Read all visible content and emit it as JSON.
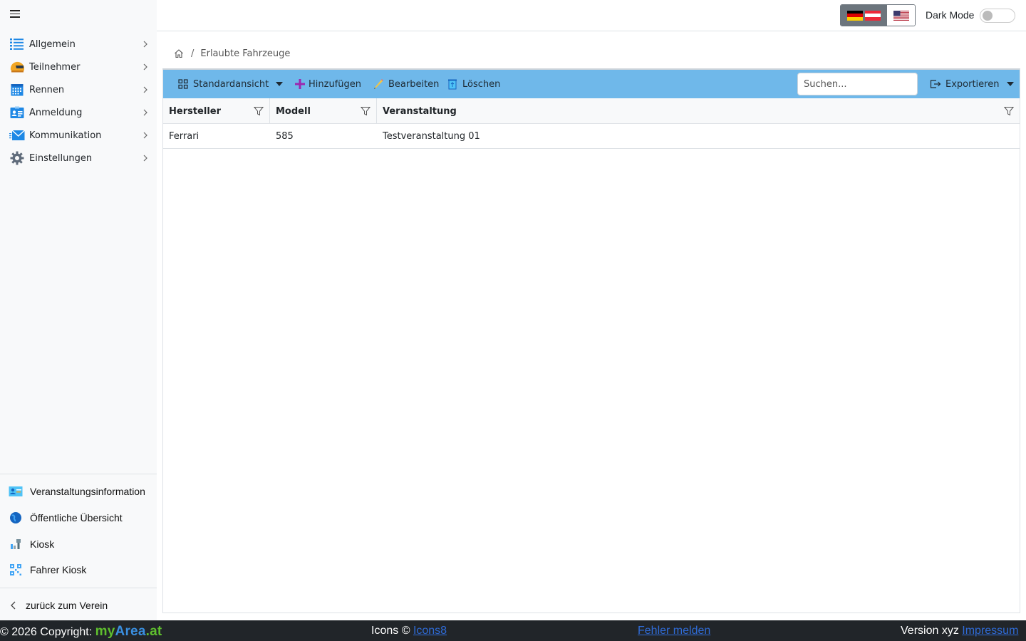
{
  "sidebar": {
    "menu_items": [
      {
        "label": "Allgemein"
      },
      {
        "label": "Teilnehmer"
      },
      {
        "label": "Rennen"
      },
      {
        "label": "Anmeldung"
      },
      {
        "label": "Kommunikation"
      },
      {
        "label": "Einstellungen"
      }
    ],
    "bottom_items": [
      {
        "label": "Veranstaltungsinformation"
      },
      {
        "label": "Öffentliche Übersicht"
      },
      {
        "label": "Kiosk"
      },
      {
        "label": "Fahrer Kiosk"
      }
    ],
    "back_label": "zurück zum Verein"
  },
  "topbar": {
    "dark_mode_label": "Dark Mode",
    "dark_mode_on": false
  },
  "breadcrumb": {
    "separator": "/",
    "current": "Erlaubte Fahrzeuge"
  },
  "toolbar": {
    "view_label": "Standardansicht",
    "add_label": "Hinzufügen",
    "edit_label": "Bearbeiten",
    "delete_label": "Löschen",
    "search_placeholder": "Suchen...",
    "export_label": "Exportieren"
  },
  "table": {
    "columns": [
      "Hersteller",
      "Modell",
      "Veranstaltung"
    ],
    "rows": [
      [
        "Ferrari",
        "585",
        "Testveranstaltung 01"
      ]
    ]
  },
  "footer": {
    "copyright": "© 2026 Copyright:",
    "brand_my": "my",
    "brand_area": "Area",
    "brand_at": ".at",
    "icons_text": "Icons ©",
    "icons_link": "Icons8",
    "report_link": "Fehler melden",
    "version": "Version xyz",
    "impressum_link": "Impressum"
  },
  "colors": {
    "toolbar_bg": "#6fb8ea",
    "footer_bg": "#212529",
    "link": "#2f6bd6",
    "brand_green": "#5fbf2e",
    "brand_blue": "#3a8fe0"
  }
}
